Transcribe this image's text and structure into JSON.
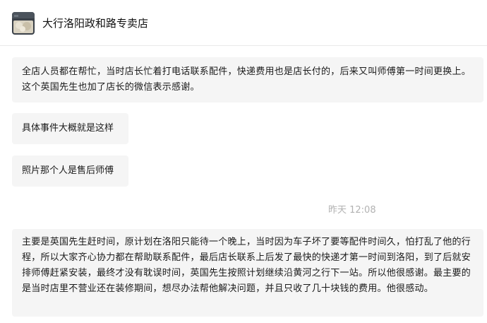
{
  "header": {
    "avatar_icon": "store-avatar-icon",
    "title": "大行洛阳政和路专卖店"
  },
  "messages": [
    {
      "text": "全店人员都在帮忙，当时店长忙着打电话联系配件，快递费用也是店长付的，后来又叫师傅第一时间更换上。这个英国先生也加了店长的微信表示感谢。"
    },
    {
      "text": "具体事件大概就是这样"
    },
    {
      "text": "照片那个人是售后师傅"
    },
    {
      "timestamp": "昨天 12:08"
    },
    {
      "text": "主要是英国先生赶时间，原计划在洛阳只能待一个晚上，当时因为车子坏了要等配件时间久，怕打乱了他的行程，所以大家齐心协力都在帮助联系配件，最后店长联系上后发了最快的快递才第一时间到洛阳，到了后就安排师傅赶紧安装，最终才没有耽误时间，英国先生按照计划继续沿黄河之行下一站。所以他很感谢。最主要的是当时店里不营业还在装修期间，想尽办法帮他解决问题，并且只收了几十块钱的费用。他很感动。"
    }
  ],
  "colors": {
    "bubble_bg": "#f5f5f5",
    "timestamp": "#b2b2b2",
    "divider": "#e9e9e9"
  }
}
